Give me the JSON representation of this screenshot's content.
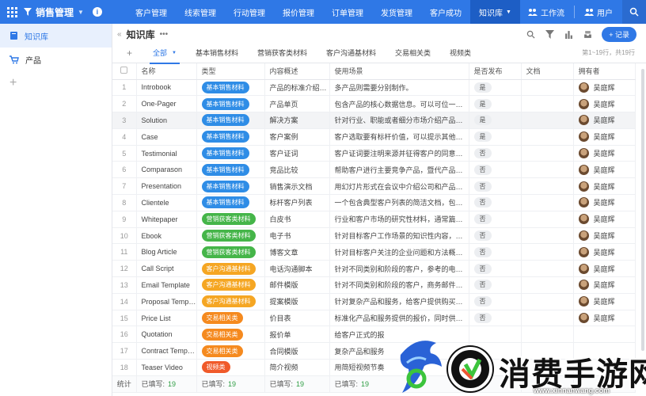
{
  "app": {
    "name": "销售管理",
    "nav": [
      "客户管理",
      "线索管理",
      "行动管理",
      "报价管理",
      "订单管理",
      "发货管理",
      "客户成功",
      "知识库"
    ],
    "active_nav": "知识库",
    "workflow_label": "工作流",
    "users_label": "用户"
  },
  "sidebar": {
    "items": [
      {
        "label": "知识库",
        "icon": "book-icon",
        "active": true
      },
      {
        "label": "产品",
        "icon": "cart-icon",
        "active": false
      }
    ]
  },
  "page": {
    "title": "知识库",
    "record_button": "+ 记录",
    "tabs": [
      "全部",
      "基本销售材料",
      "营销获客类材料",
      "客户沟通基材料",
      "交易相关类",
      "视频类"
    ],
    "active_tab": "全部",
    "count_text": "第1~19行，共19行"
  },
  "table": {
    "columns": [
      "名称",
      "类型",
      "内容概述",
      "使用场景",
      "是否发布",
      "文档",
      "拥有者"
    ],
    "type_colors": {
      "基本销售材料": "#2f8de6",
      "营销获客类材料": "#45b549",
      "客户沟通基材料": "#f5a623",
      "交易相关类": "#f58a1f",
      "视频类": "#f05a2a"
    },
    "rows": [
      {
        "idx": "1",
        "name": "Introbook",
        "type": "基本销售材料",
        "summary": "产品的标准介绍手册",
        "scene": "多产品则需要分别制作。",
        "published": "是",
        "owner": "吴庭辉"
      },
      {
        "idx": "2",
        "name": "One-Pager",
        "type": "基本销售材料",
        "summary": "产品单页",
        "scene": "包含产品的核心数据信息。可以可位一个在线...",
        "published": "是",
        "owner": "吴庭辉"
      },
      {
        "idx": "3",
        "name": "Solution",
        "type": "基本销售材料",
        "summary": "解决方案",
        "scene": "针对行业、职能或者细分市场介绍产品如何解...",
        "published": "是",
        "owner": "吴庭辉"
      },
      {
        "idx": "4",
        "name": "Case",
        "type": "基本销售材料",
        "summary": "客户案例",
        "scene": "客户选取要有标杆价值，可以提示其他客户使...",
        "published": "是",
        "owner": "吴庭辉"
      },
      {
        "idx": "5",
        "name": "Testimonial",
        "type": "基本销售材料",
        "summary": "客户证词",
        "scene": "客户证词要注明来源并征得客户的同意，文案...",
        "published": "否",
        "owner": "吴庭辉"
      },
      {
        "idx": "6",
        "name": "Comparason",
        "type": "基本销售材料",
        "summary": "竞品比较",
        "scene": "帮助客户进行主要竞争产品，暨代产品之间的...",
        "published": "否",
        "owner": "吴庭辉"
      },
      {
        "idx": "7",
        "name": "Presentation",
        "type": "基本销售材料",
        "summary": "销售演示文档",
        "scene": "用幻灯片形式在会议中介绍公司和产品的内容...",
        "published": "否",
        "owner": "吴庭辉"
      },
      {
        "idx": "8",
        "name": "Clientele",
        "type": "基本销售材料",
        "summary": "标杆客户列表",
        "scene": "一个包含典型客户列表的简洁文档，包括标杆...",
        "published": "否",
        "owner": "吴庭辉"
      },
      {
        "idx": "9",
        "name": "Whitepaper",
        "type": "营销获客类材料",
        "summary": "白皮书",
        "scene": "行业和客户市场的研究性材料，通常篇幅较长...",
        "published": "否",
        "owner": "吴庭辉"
      },
      {
        "idx": "10",
        "name": "Ebook",
        "type": "营销获客类材料",
        "summary": "电子书",
        "scene": "针对目标客户工作场景的知识性内容，通常是...",
        "published": "否",
        "owner": "吴庭辉"
      },
      {
        "idx": "11",
        "name": "Blog Article",
        "type": "营销获客类材料",
        "summary": "博客文章",
        "scene": "针对目标客户关注的企业问题和方法概念提供...",
        "published": "否",
        "owner": "吴庭辉"
      },
      {
        "idx": "12",
        "name": "Call Script",
        "type": "客户沟通基材料",
        "summary": "电话沟通脚本",
        "scene": "针对不同类别和阶段的客户，参考的电话沟通...",
        "published": "否",
        "owner": "吴庭辉"
      },
      {
        "idx": "13",
        "name": "Email Template",
        "type": "客户沟通基材料",
        "summary": "邮件模版",
        "scene": "针对不同类别和阶段的客户，商务邮件应该如...",
        "published": "否",
        "owner": "吴庭辉"
      },
      {
        "idx": "14",
        "name": "Proposal Template",
        "type": "客户沟通基材料",
        "summary": "提案模版",
        "scene": "针对复杂产品和服务，给客户提供购买方案时...",
        "published": "否",
        "owner": "吴庭辉"
      },
      {
        "idx": "15",
        "name": "Price List",
        "type": "交易相关类",
        "summary": "价目表",
        "scene": "标准化产品和服务提供的报价，同时供客户选...",
        "published": "否",
        "owner": "吴庭辉"
      },
      {
        "idx": "16",
        "name": "Quotation",
        "type": "交易相关类",
        "summary": "报价单",
        "scene": "给客户正式的报",
        "published": "",
        "owner": ""
      },
      {
        "idx": "17",
        "name": "Contract Template",
        "type": "交易相关类",
        "summary": "合同模版",
        "scene": "复杂产品和服务",
        "published": "",
        "owner": ""
      },
      {
        "idx": "18",
        "name": "Teaser Video",
        "type": "视频类",
        "summary": "简介视频",
        "scene": "用简短视频节奏",
        "published": "",
        "owner": ""
      }
    ],
    "footer": {
      "label": "统计",
      "filled_label": "已填写:",
      "count": "19"
    }
  },
  "watermark": {
    "title": "消费手游网",
    "url": "www.xinnanwang.com"
  }
}
